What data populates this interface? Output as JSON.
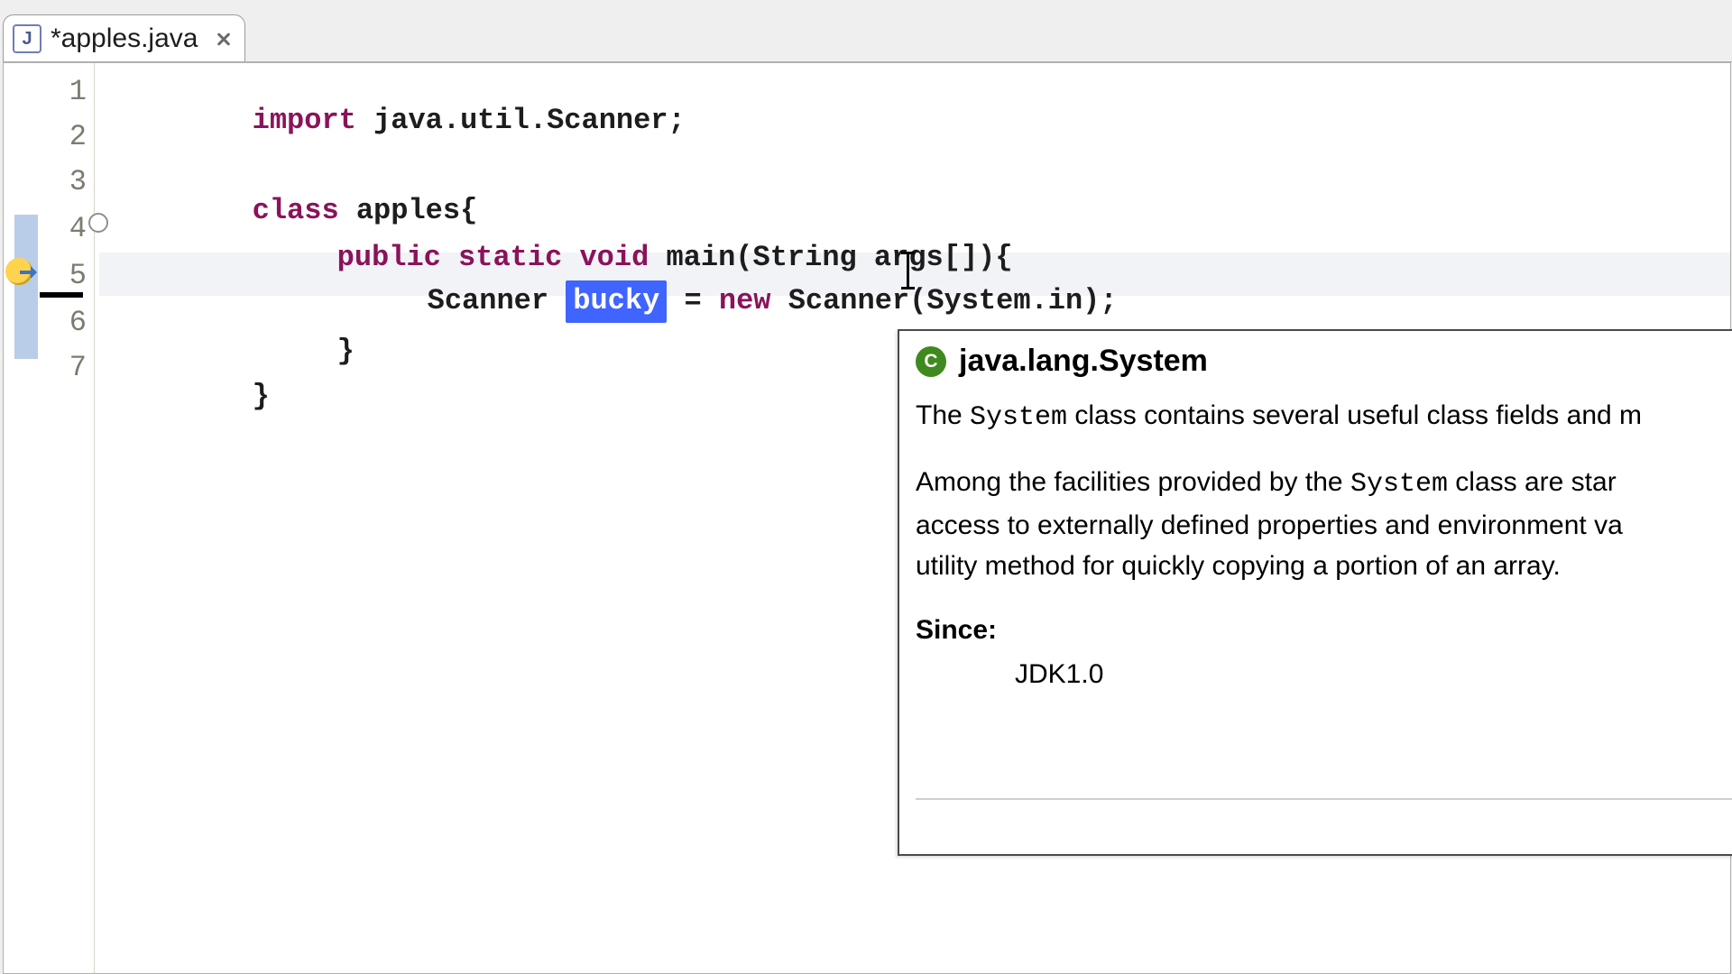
{
  "tab": {
    "icon_letter": "J",
    "title": "*apples.java"
  },
  "gutter": {
    "line_numbers": [
      "1",
      "2",
      "3",
      "4",
      "5",
      "6",
      "7"
    ]
  },
  "code": {
    "l1": {
      "kw_import": "import",
      "rest": " java.util.Scanner;"
    },
    "l3": {
      "kw_class": "class",
      "rest": " apples{"
    },
    "l4": {
      "kw_public": "public",
      "kw_static": "static",
      "kw_void": "void",
      "rest": " main(String args[]){"
    },
    "l5": {
      "pre": "Scanner ",
      "selected": "bucky",
      "mid": " = ",
      "kw_new": "new",
      "post": " Scanner(System.in);"
    },
    "l6": {
      "text": "}"
    },
    "l7": {
      "text": "}"
    }
  },
  "javadoc": {
    "class_name": "java.lang.System",
    "p1_prefix": "The ",
    "p1_code": "System",
    "p1_suffix": " class contains several useful class fields and m",
    "p2a": "Among the facilities provided by the ",
    "p2code": "System",
    "p2b": " class are star",
    "p2line2": "access to externally defined properties and environment va",
    "p2line3": "utility method for quickly copying a portion of an array.",
    "since_header": "Since:",
    "since_value": "JDK1.0"
  }
}
